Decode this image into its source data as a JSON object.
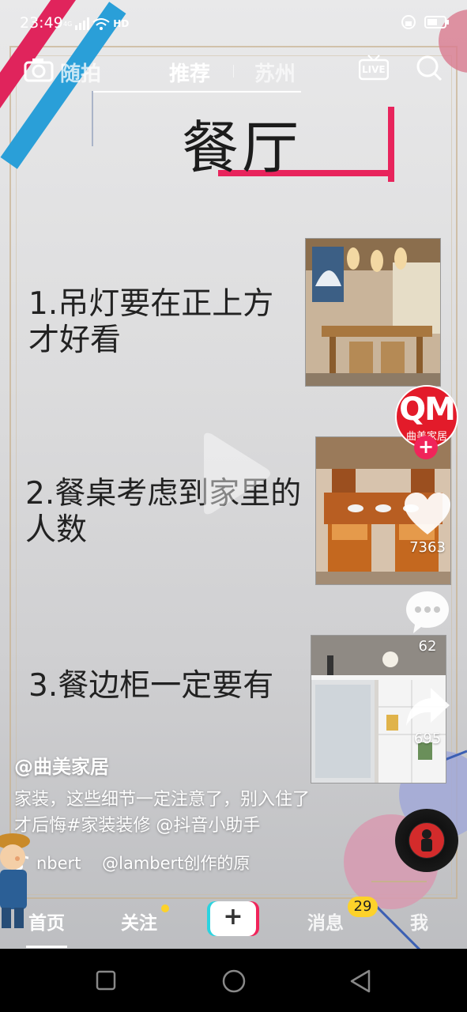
{
  "status_bar": {
    "time": "23:49",
    "network_label": "4G",
    "hd_label": "HD"
  },
  "top_nav": {
    "left_label": "随拍",
    "tab_recommend": "推荐",
    "tab_city": "苏州",
    "live_label": "LIVE"
  },
  "slide": {
    "title": "餐厅",
    "tips": [
      {
        "line1": "1.吊灯要在正上方",
        "line2": "才好看"
      },
      {
        "line1": "2.餐桌考虑到家里的",
        "line2": "人数"
      },
      {
        "line1": "3.餐边柜一定要有",
        "line2": ""
      }
    ]
  },
  "rail": {
    "avatar_text": "QM",
    "avatar_sub": "曲美家居",
    "likes": "7363",
    "comments": "62",
    "shares": "695"
  },
  "post": {
    "author": "@曲美家居",
    "caption_line1": "家装，这些细节一定注意了，别入住了",
    "caption_line2": "才后悔#家装装修 @抖音小助手",
    "music": "nbert    @lambert创作的原"
  },
  "tab_bar": {
    "home": "首页",
    "follow": "关注",
    "add": "+",
    "messages": "消息",
    "messages_badge": "29",
    "me": "我"
  },
  "colors": {
    "accent_pink": "#f0245a",
    "accent_cyan": "#2bd4e0",
    "badge_yellow": "#fdd22a"
  }
}
